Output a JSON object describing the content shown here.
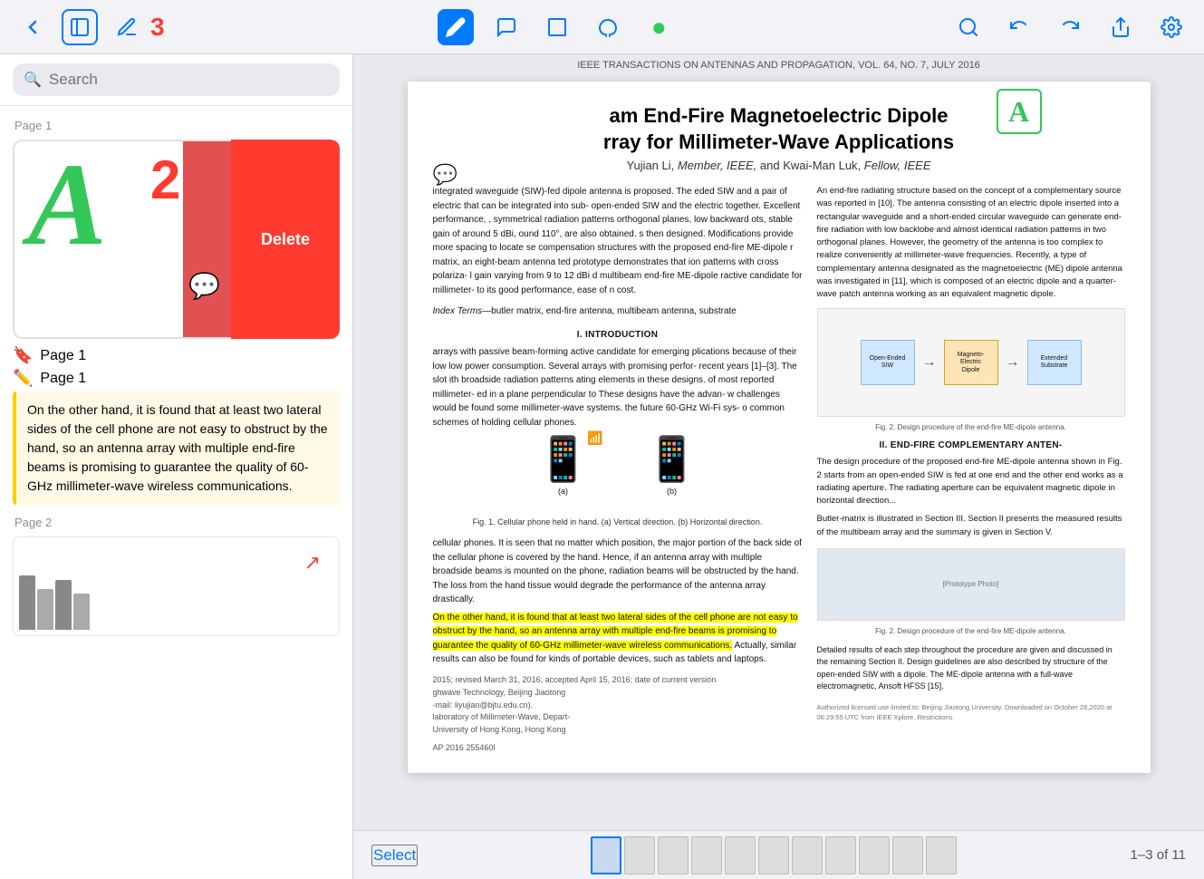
{
  "toolbar": {
    "back_label": "‹",
    "sidebar_icon": "sidebar",
    "note_icon": "note",
    "pencil_icon": "pencil",
    "comment_icon": "comment",
    "rect_icon": "rect",
    "lasso_icon": "lasso",
    "dot_icon": "●",
    "search_icon": "search",
    "undo_icon": "undo",
    "redo_icon": "redo",
    "share_icon": "share",
    "settings_icon": "settings"
  },
  "sidebar": {
    "search_placeholder": "Search",
    "page1_label": "Page 1",
    "page1_annotation_label": "Page 1",
    "page2_label": "Page 2",
    "annotation_text": "On the other hand, it is found that at least two lateral sides of the cell phone are not easy to obstruct by the hand, so an antenna array with multiple end-fire beams is promising to guarantee the quality of 60-GHz millimeter-wave wireless communications.",
    "delete_label": "Delete",
    "badge_number": "2"
  },
  "document": {
    "journal": "IEEE TRANSACTIONS ON ANTENNAS AND PROPAGATION, VOL. 64, NO. 7, JULY 2016",
    "title": "am End-Fire Magnetoelectric Dipole\nrray for Millimeter-Wave Applications",
    "authors": "Yujian Li, Member, IEEE, and Kwai-Man Luk, Fellow, IEEE",
    "abstract_intro": "integrated waveguide (SIW)-fed\ndipole antenna is proposed. The\neded SIW and a pair of electric\nthat can be integrated into sub-\nopen-ended SIW and the electric\ntogether. Excellent performance,\n, symmetrical radiation patterns\northogonal planes, low backward\nots, stable gain of around 5 dBi,\nound 110°, are also obtained.\ns then designed. Modifications\nprovide more spacing to locate\nse compensation structures with\nthe proposed end-fire ME-dipole\nr matrix, an eight-beam antenna\nted prototype demonstrates that\nion patterns with cross polariza-\nl gain varying from 9 to 12 dBi\nd multibeam end-fire ME-dipole\nractive candidate for millimeter-\nto its good performance, ease of\nn cost.",
    "body_text": "arrays with passive beam-forming\nactive candidate for emerging\nplications because of their low\nlow power consumption. Several\narrays with promising perfor-\nrecent years [1]–[3]. The slot\nith broadside radiation patterns\nating elements in these designs.\nof most reported millimeter-\ned in a plane perpendicular to\nThese designs have the advan-\nw challenges would be found\nsome millimeter-wave systems.\nthe future 60-GHz Wi-Fi sys-\no common schemes of holding\ncellular phones.",
    "body_text2": "cellular phones. It is seen that no matter which position,\nthe major portion of the back side of the cellular phone\nis covered by the hand. Hence, if an antenna array with\nmultiple broadside beams is mounted on the phone, radiation\nbeams will be obstructed by the hand. The loss from the\nhand tissue would degrade the performance of the antenna\narray drastically.",
    "highlighted_text": "On the other hand, it is found that at least two lateral sides of the cell phone are not easy to obstruct by the hand, so an antenna array with multiple end-fire beams is promising to guarantee the quality of 60-GHz millimeter-wave wireless communications.",
    "body_text3": "Actually, similar results can also be found for kinds of portable devices, such as tablets and laptops.",
    "keywords": "butler matrix, end-fire antenna,\nmultibeam antenna, substrate",
    "fig_caption": "Fig. 1. Cellular phone held in hand. (a) Vertical direction. (b) Horizontal direction.",
    "right_col_text": "An end-fire radiating structure based on the concept of a complementary source was reported in [10]. The antenna consisting of an electric dipole inserted into a rectangular waveguide and a short-ended circular waveguide can generate end-fire radiation with low backlobe and almost identical radiation patterns in two orthogonal planes. However, the geometry of the antenna is too complex to realize conveniently at millimeter-wave frequencies. Recently, a type of complementary antenna designated as the magnetoelectric (ME) dipole antenna was investigated in [11], which is composed of an electric dipole and a quarter-wave patch antenna working as an equivalent magnetic dipole.",
    "section2_heading": "II. END-FIRE COMPLEMENTARY ANTEN-",
    "page_counter": "1–3 of 11",
    "select_label": "Select"
  }
}
